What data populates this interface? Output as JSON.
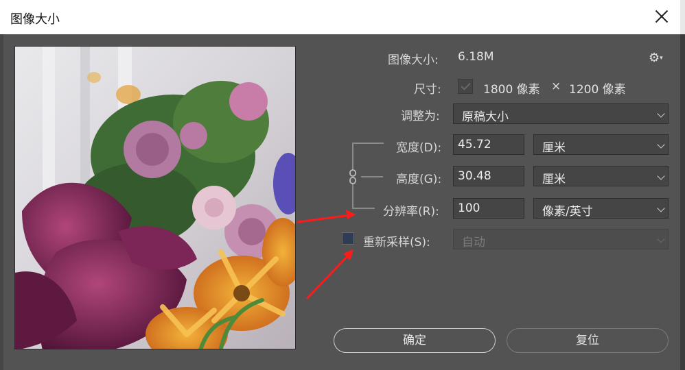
{
  "window": {
    "title": "图像大小",
    "close_icon": "close-icon"
  },
  "info": {
    "image_size_label": "图像大小:",
    "image_size_value": "6.18M",
    "dimensions_label": "尺寸:",
    "width_px": "1800 像素",
    "times": "×",
    "height_px": "1200 像素"
  },
  "fit_to": {
    "label": "调整为:",
    "value": "原稿大小"
  },
  "width": {
    "label": "宽度(D):",
    "value": "45.72",
    "unit": "厘米"
  },
  "height": {
    "label": "高度(G):",
    "value": "30.48",
    "unit": "厘米"
  },
  "resolution": {
    "label": "分辨率(R):",
    "value": "100",
    "unit": "像素/英寸"
  },
  "resample": {
    "label": "重新采样(S):",
    "value": "自动",
    "checked": false
  },
  "buttons": {
    "ok": "确定",
    "reset": "复位"
  },
  "colors": {
    "background": "#535353",
    "annotation_arrow": "#ff1a1a"
  }
}
